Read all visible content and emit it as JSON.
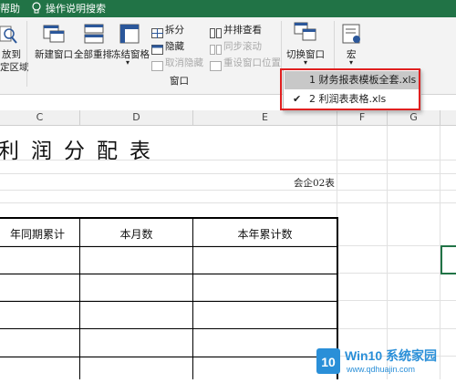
{
  "top_bar": {
    "help_tab": "帮助",
    "search_hint": "操作说明搜索",
    "bulb_icon": "lightbulb-icon"
  },
  "ribbon": {
    "zoom_to_selection": [
      "放到",
      "定区域"
    ],
    "new_window": "新建窗口",
    "arrange_all": "全部重排",
    "freeze_panes": "冻结窗格",
    "split": "拆分",
    "hide": "隐藏",
    "unhide": "取消隐藏",
    "view_side_by_side": "并排查看",
    "sync_scroll": "同步滚动",
    "reset_window_position": "重设窗口位置",
    "switch_windows": "切换窗口",
    "macros": "宏",
    "window_group_label": "窗口"
  },
  "dropdown": {
    "items": [
      {
        "label": "1 财务报表模板全套.xls",
        "checked": false,
        "highlighted": true
      },
      {
        "label": "2 利润表表格.xls",
        "checked": true,
        "highlighted": false
      }
    ],
    "highlight_color": "#e02020"
  },
  "sheet": {
    "columns": [
      "C",
      "D",
      "E",
      "F",
      "G"
    ],
    "title": "利润分配表",
    "unit_label": "会企02表",
    "table_headers": [
      "年同期累计",
      "本月数",
      "本年累计数"
    ]
  },
  "watermark": {
    "brand": "Win10 系统家园",
    "url": "www.qdhuajin.com"
  },
  "colors": {
    "excel_green": "#217346",
    "ribbon_bg": "#f3f3f3"
  }
}
